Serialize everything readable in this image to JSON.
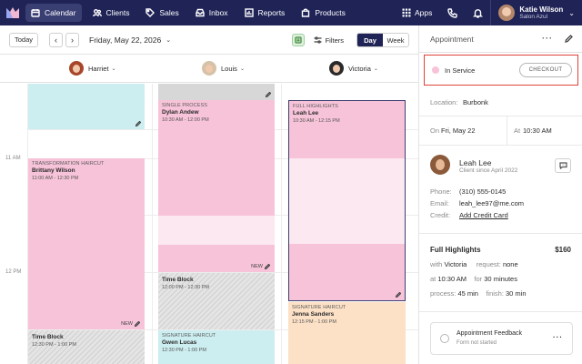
{
  "nav": {
    "items": [
      {
        "label": "Calendar",
        "icon": "calendar-icon",
        "active": true
      },
      {
        "label": "Clients",
        "icon": "users-icon"
      },
      {
        "label": "Sales",
        "icon": "tag-icon"
      },
      {
        "label": "Inbox",
        "icon": "inbox-icon"
      },
      {
        "label": "Reports",
        "icon": "bar-chart-icon"
      },
      {
        "label": "Products",
        "icon": "shopping-bag-icon"
      }
    ],
    "apps_label": "Apps",
    "user": {
      "name": "Katie Wilson",
      "salon": "Salon Azul"
    }
  },
  "toolbar": {
    "today_label": "Today",
    "prev_symbol": "‹",
    "next_symbol": "›",
    "date": "Friday, May 22, 2026",
    "filters_label": "Filters",
    "view_day": "Day",
    "view_week": "Week"
  },
  "staff": [
    {
      "name": "Harriet"
    },
    {
      "name": "Louis"
    },
    {
      "name": "Victoria"
    }
  ],
  "times": {
    "t11": "11 AM",
    "t12": "12 PM"
  },
  "appointments": {
    "brittany": {
      "service": "TRANSFORMATION HAIRCUT",
      "client": "Brittany Wilson",
      "time": "11:00 AM - 12:30 PM",
      "tag": "NEW"
    },
    "harriet_block": {
      "title": "Time Block",
      "time": "12:30 PM - 1:00 PM"
    },
    "dylan": {
      "service": "SINGLE PROCESS",
      "client": "Dylan Andew",
      "time": "10:30 AM - 12:00 PM",
      "tag": "NEW"
    },
    "louis_block": {
      "title": "Time Block",
      "time": "12:00 PM - 12:30 PM"
    },
    "gwen": {
      "service": "SIGNATURE HAIRCUT",
      "client": "Gwen Lucas",
      "time": "12:30 PM - 1:00 PM"
    },
    "leah": {
      "service": "FULL HIGHLIGHTS",
      "client": "Leah Lee",
      "time": "10:30 AM - 12:15 PM"
    },
    "jenna": {
      "service": "SIGNATURE HAIRCUT",
      "client": "Jenna Sanders",
      "time": "12:15 PM - 1:00 PM"
    }
  },
  "panel": {
    "title": "Appointment",
    "status": "In Service",
    "checkout_label": "CHECKOUT",
    "location_label": "Location:",
    "location": "Burbonk",
    "on_label": "On",
    "on_value": "Fri, May 22",
    "at_label": "At",
    "at_value": "10:30 AM",
    "client": {
      "name": "Leah Lee",
      "since": "Client since April 2022"
    },
    "phone_label": "Phone:",
    "phone": "(310) 555-0145",
    "email_label": "Email:",
    "email": "leah_lee97@me.com",
    "credit_label": "Credit:",
    "credit_link": "Add Credit Card",
    "service": {
      "name": "Full Highlights",
      "price": "$160",
      "with_label": "with",
      "with_value": "Victoria",
      "request_label": "request:",
      "request_value": "none",
      "at_label": "at",
      "at_value": "10:30 AM",
      "for_label": "for",
      "for_value": "30 minutes",
      "process_label": "process:",
      "process_value": "45 min",
      "finish_label": "finish:",
      "finish_value": "30 min"
    },
    "feedback": {
      "title": "Appointment Feedback",
      "status": "Form not started"
    }
  }
}
